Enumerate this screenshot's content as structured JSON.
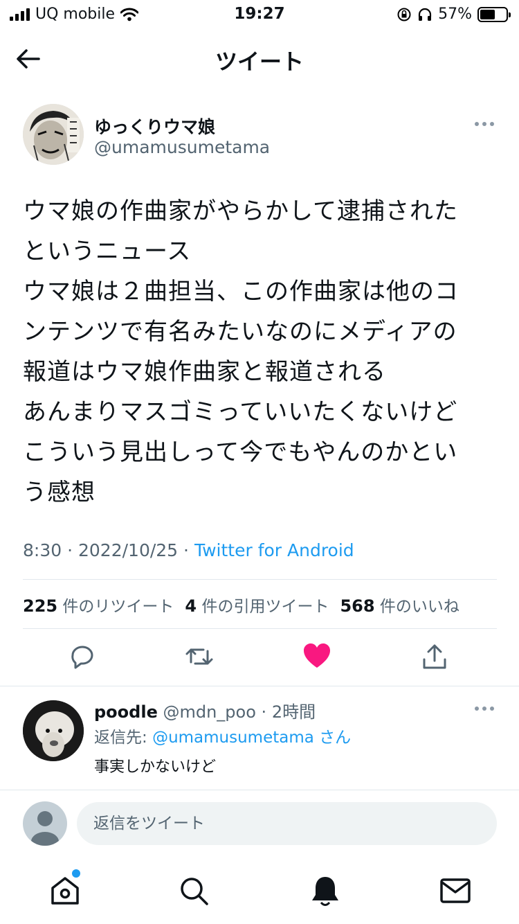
{
  "status_bar": {
    "carrier": "UQ mobile",
    "time": "19:27",
    "battery": "57%",
    "battery_level": 0.57
  },
  "header": {
    "title": "ツイート"
  },
  "tweet": {
    "author_name": "ゆっくりウマ娘",
    "author_handle": "@umamusumetama",
    "text": "ウマ娘の作曲家がやらかして逮捕された\nというニュース\nウマ娘は２曲担当、この作曲家は他のコ\nンテンツで有名みたいなのにメディアの\n報道はウマ娘作曲家と報道される\nあんまりマスゴミっていいたくないけど\nこういう見出しって今でもやんのかとい\nう感想",
    "time": "8:30",
    "date": "2022/10/25",
    "separator": "·",
    "client": "Twitter for Android",
    "stats": {
      "retweets_count": "225",
      "retweets_label": "件のリツイート",
      "quotes_count": "4",
      "quotes_label": "件の引用ツイート",
      "likes_count": "568",
      "likes_label": "件のいいね"
    }
  },
  "reply": {
    "name": "poodle",
    "handle": "@mdn_poo",
    "time": "2時間",
    "reply_to_label": "返信先:",
    "reply_to_handle": "@umamusumetama",
    "reply_to_suffix": "さん",
    "text": "事実しかないけど"
  },
  "compose": {
    "placeholder": "返信をツイート"
  },
  "colors": {
    "accent": "#1d9bf0",
    "like": "#f91880",
    "secondary_text": "#536471"
  },
  "icons": {
    "back": "arrow-left-icon",
    "reply": "comment-icon",
    "retweet": "retweet-icon",
    "like": "heart-icon",
    "share": "share-icon",
    "home": "home-icon",
    "search": "search-icon",
    "notifications": "bell-icon",
    "messages": "mail-icon"
  }
}
